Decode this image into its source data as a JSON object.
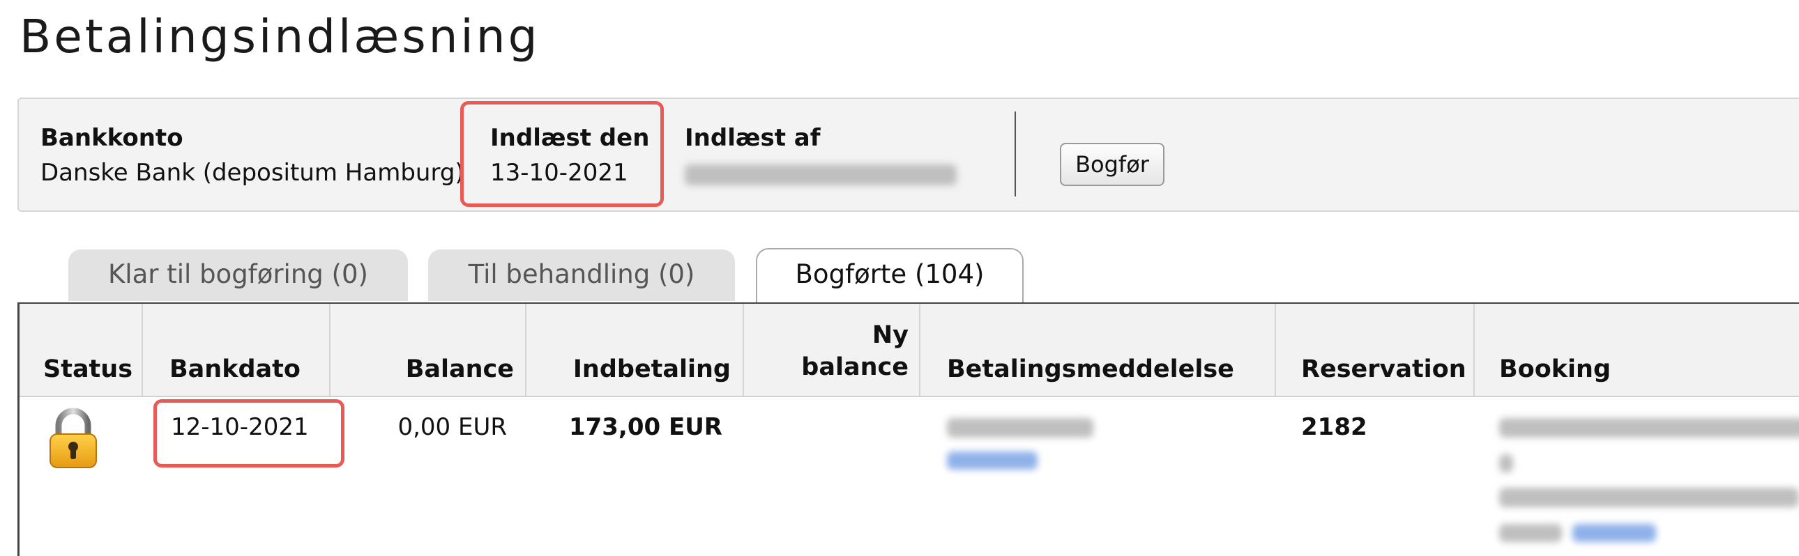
{
  "page": {
    "title": "Betalingsindlæsning"
  },
  "info": {
    "bankkonto_label": "Bankkonto",
    "bankkonto_value": "Danske Bank (depositum Hamburg)",
    "indlaest_den_label": "Indlæst den",
    "indlaest_den_value": "13-10-2021",
    "indlaest_af_label": "Indlæst af",
    "bogfor_button": "Bogfør"
  },
  "tabs": [
    {
      "label": "Klar til bogføring (0)",
      "active": false
    },
    {
      "label": "Til behandling (0)",
      "active": false
    },
    {
      "label": "Bogførte (104)",
      "active": true
    }
  ],
  "table": {
    "headers": {
      "status": "Status",
      "bankdato": "Bankdato",
      "balance": "Balance",
      "indbetaling": "Indbetaling",
      "ny_balance_line1": "Ny",
      "ny_balance_line2": "balance",
      "betalingsmeddelelse": "Betalingsmeddelelse",
      "reservation": "Reservation",
      "booking": "Booking"
    },
    "rows": [
      {
        "status_icon": "padlock-icon",
        "bankdato": "12-10-2021",
        "balance": "0,00 EUR",
        "indbetaling": "173,00 EUR",
        "ny_balance": "",
        "reservation": "2182"
      }
    ]
  },
  "colors": {
    "highlight": "#e85a55",
    "link_blue": "#3b7bdc"
  }
}
